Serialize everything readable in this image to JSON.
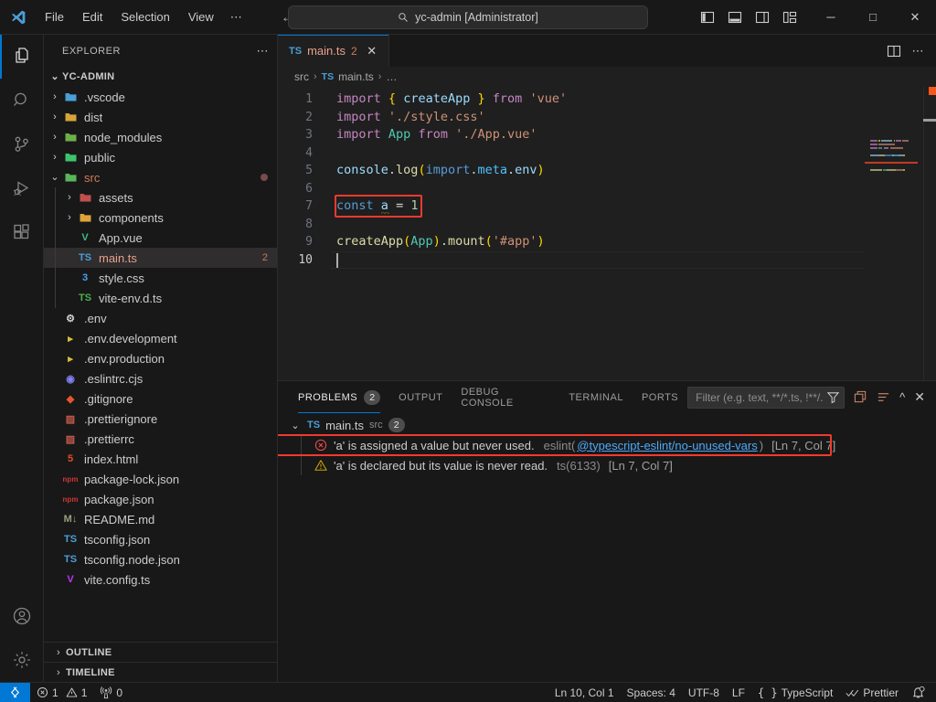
{
  "titlebar": {
    "logo": "vscode-logo",
    "menus": [
      "File",
      "Edit",
      "Selection",
      "View",
      "⋯"
    ],
    "nav": {
      "back": "←",
      "forward": "→"
    },
    "command_center": {
      "icon": "search-icon",
      "text": "yc-admin [Administrator]"
    },
    "layout_icons": [
      "toggle-primary-sidebar-icon",
      "toggle-panel-icon",
      "toggle-secondary-sidebar-icon",
      "customize-layout-icon"
    ],
    "window_buttons": {
      "minimize": "─",
      "maximize": "□",
      "close": "✕"
    }
  },
  "activitybar": {
    "items": [
      {
        "name": "explorer",
        "icon": "files-icon",
        "active": true
      },
      {
        "name": "search",
        "icon": "search-icon",
        "active": false
      },
      {
        "name": "source-control",
        "icon": "source-control-icon",
        "active": false
      },
      {
        "name": "run-and-debug",
        "icon": "run-debug-icon",
        "active": false
      },
      {
        "name": "extensions",
        "icon": "extensions-icon",
        "active": false
      }
    ],
    "bottom": [
      {
        "name": "accounts",
        "icon": "account-icon"
      },
      {
        "name": "manage",
        "icon": "gear-icon"
      }
    ]
  },
  "sidebar": {
    "title": "EXPLORER",
    "more_actions": "⋯",
    "root": {
      "label": "YC-ADMIN",
      "twisty": "⌄"
    },
    "outline": {
      "label": "OUTLINE",
      "twisty": "›"
    },
    "timeline": {
      "label": "TIMELINE",
      "twisty": "›"
    },
    "tree": [
      {
        "label": ".vscode",
        "depth": 1,
        "twisty": "›",
        "icon": "vscode-folder-icon",
        "icon_text": "",
        "icon_color": "#4a9fd8",
        "kind": "folder"
      },
      {
        "label": "dist",
        "depth": 1,
        "twisty": "›",
        "icon": "dist-folder-icon",
        "icon_text": "",
        "icon_color": "#d8a33a",
        "kind": "folder"
      },
      {
        "label": "node_modules",
        "depth": 1,
        "twisty": "›",
        "icon": "node-folder-icon",
        "icon_text": "",
        "icon_color": "#6cb04a",
        "kind": "folder"
      },
      {
        "label": "public",
        "depth": 1,
        "twisty": "›",
        "icon": "public-folder-icon",
        "icon_text": "",
        "icon_color": "#3ec46d",
        "kind": "folder"
      },
      {
        "label": "src",
        "depth": 1,
        "twisty": "⌄",
        "icon": "src-folder-icon",
        "icon_text": "",
        "icon_color": "#5ab55a",
        "kind": "folder",
        "modified": true,
        "label_color": "#cd7a5a"
      },
      {
        "label": "assets",
        "depth": 2,
        "twisty": "›",
        "icon": "assets-folder-icon",
        "icon_text": "",
        "icon_color": "#c0504d",
        "kind": "folder"
      },
      {
        "label": "components",
        "depth": 2,
        "twisty": "›",
        "icon": "components-folder-icon",
        "icon_text": "",
        "icon_color": "#e0a33a",
        "kind": "folder"
      },
      {
        "label": "App.vue",
        "depth": 2,
        "twisty": "",
        "icon": "vue-icon",
        "icon_text": "V",
        "icon_color": "#41b883",
        "kind": "file"
      },
      {
        "label": "main.ts",
        "depth": 2,
        "twisty": "",
        "icon": "typescript-icon",
        "icon_text": "TS",
        "icon_color": "#4a9fd8",
        "kind": "file",
        "selected": true,
        "badge": "2",
        "label_color": "#e8a08a",
        "badge_color": "#cd7a5a"
      },
      {
        "label": "style.css",
        "depth": 2,
        "twisty": "",
        "icon": "css-icon",
        "icon_text": "3",
        "icon_color": "#42a5f5",
        "kind": "file"
      },
      {
        "label": "vite-env.d.ts",
        "depth": 2,
        "twisty": "",
        "icon": "typescript-def-icon",
        "icon_text": "TS",
        "icon_color": "#4caf50",
        "kind": "file"
      },
      {
        "label": ".env",
        "depth": 1,
        "twisty": "",
        "icon": "gear-file-icon",
        "icon_text": "⚙",
        "icon_color": "#d0d0d0",
        "kind": "file"
      },
      {
        "label": ".env.development",
        "depth": 1,
        "twisty": "",
        "icon": "console-file-icon",
        "icon_text": "▸",
        "icon_color": "#d8c03a",
        "kind": "file"
      },
      {
        "label": ".env.production",
        "depth": 1,
        "twisty": "",
        "icon": "console-file-icon",
        "icon_text": "▸",
        "icon_color": "#d8c03a",
        "kind": "file"
      },
      {
        "label": ".eslintrc.cjs",
        "depth": 1,
        "twisty": "",
        "icon": "eslint-icon",
        "icon_text": "◉",
        "icon_color": "#8080f2",
        "kind": "file"
      },
      {
        "label": ".gitignore",
        "depth": 1,
        "twisty": "",
        "icon": "git-icon",
        "icon_text": "◆",
        "icon_color": "#e8552a",
        "kind": "file"
      },
      {
        "label": ".prettierignore",
        "depth": 1,
        "twisty": "",
        "icon": "prettier-icon",
        "icon_text": "▨",
        "icon_color": "#c25a4a",
        "kind": "file"
      },
      {
        "label": ".prettierrc",
        "depth": 1,
        "twisty": "",
        "icon": "prettier-icon",
        "icon_text": "▨",
        "icon_color": "#c25a4a",
        "kind": "file"
      },
      {
        "label": "index.html",
        "depth": 1,
        "twisty": "",
        "icon": "html-icon",
        "icon_text": "5",
        "icon_color": "#e44d26",
        "kind": "file"
      },
      {
        "label": "package-lock.json",
        "depth": 1,
        "twisty": "",
        "icon": "npm-icon",
        "icon_text": "npm",
        "icon_color": "#cb3837",
        "kind": "file"
      },
      {
        "label": "package.json",
        "depth": 1,
        "twisty": "",
        "icon": "npm-icon",
        "icon_text": "npm",
        "icon_color": "#cb3837",
        "kind": "file"
      },
      {
        "label": "README.md",
        "depth": 1,
        "twisty": "",
        "icon": "markdown-icon",
        "icon_text": "M↓",
        "icon_color": "#9c9c82",
        "kind": "file"
      },
      {
        "label": "tsconfig.json",
        "depth": 1,
        "twisty": "",
        "icon": "tsconfig-icon",
        "icon_text": "TS",
        "icon_color": "#4a9fd8",
        "kind": "file"
      },
      {
        "label": "tsconfig.node.json",
        "depth": 1,
        "twisty": "",
        "icon": "tsconfig-icon",
        "icon_text": "TS",
        "icon_color": "#4a9fd8",
        "kind": "file"
      },
      {
        "label": "vite.config.ts",
        "depth": 1,
        "twisty": "",
        "icon": "vite-icon",
        "icon_text": "V",
        "icon_color": "#bd34fe",
        "kind": "file"
      }
    ]
  },
  "editor": {
    "tab": {
      "icon_text": "TS",
      "name": "main.ts",
      "badge": "2",
      "close": "✕"
    },
    "tab_actions": [
      "split-editor-icon",
      "more-actions-icon"
    ],
    "breadcrumbs": [
      "src",
      "main.ts",
      "…"
    ],
    "breadcrumb_icon": "TS",
    "lines": [
      {
        "n": "1",
        "tokens": [
          {
            "t": "import",
            "c": "k"
          },
          {
            "t": " ",
            "c": "op"
          },
          {
            "t": "{",
            "c": "pm"
          },
          {
            "t": " ",
            "c": "op"
          },
          {
            "t": "createApp",
            "c": "id"
          },
          {
            "t": " ",
            "c": "op"
          },
          {
            "t": "}",
            "c": "pm"
          },
          {
            "t": " ",
            "c": "op"
          },
          {
            "t": "from",
            "c": "k"
          },
          {
            "t": " ",
            "c": "op"
          },
          {
            "t": "'vue'",
            "c": "str"
          }
        ]
      },
      {
        "n": "2",
        "tokens": [
          {
            "t": "import",
            "c": "k"
          },
          {
            "t": " ",
            "c": "op"
          },
          {
            "t": "'./style.css'",
            "c": "str"
          }
        ]
      },
      {
        "n": "3",
        "tokens": [
          {
            "t": "import",
            "c": "k"
          },
          {
            "t": " ",
            "c": "op"
          },
          {
            "t": "App",
            "c": "cls"
          },
          {
            "t": " ",
            "c": "op"
          },
          {
            "t": "from",
            "c": "k"
          },
          {
            "t": " ",
            "c": "op"
          },
          {
            "t": "'./App.vue'",
            "c": "str"
          }
        ]
      },
      {
        "n": "4",
        "tokens": []
      },
      {
        "n": "5",
        "tokens": [
          {
            "t": "console",
            "c": "id"
          },
          {
            "t": ".",
            "c": "op"
          },
          {
            "t": "log",
            "c": "fn"
          },
          {
            "t": "(",
            "c": "pm"
          },
          {
            "t": "import",
            "c": "kb"
          },
          {
            "t": ".",
            "c": "op"
          },
          {
            "t": "meta",
            "c": "mod"
          },
          {
            "t": ".",
            "c": "op"
          },
          {
            "t": "env",
            "c": "id"
          },
          {
            "t": ")",
            "c": "pm"
          }
        ]
      },
      {
        "n": "6",
        "tokens": []
      },
      {
        "n": "7",
        "tokens": [
          {
            "t": "const",
            "c": "kb"
          },
          {
            "t": " ",
            "c": "op"
          },
          {
            "t": "a",
            "c": "id"
          },
          {
            "t": " ",
            "c": "op"
          },
          {
            "t": "=",
            "c": "op"
          },
          {
            "t": " ",
            "c": "op"
          },
          {
            "t": "1",
            "c": "num"
          }
        ]
      },
      {
        "n": "8",
        "tokens": []
      },
      {
        "n": "9",
        "tokens": [
          {
            "t": "createApp",
            "c": "fn"
          },
          {
            "t": "(",
            "c": "pm"
          },
          {
            "t": "App",
            "c": "cls"
          },
          {
            "t": ")",
            "c": "pm"
          },
          {
            "t": ".",
            "c": "op"
          },
          {
            "t": "mount",
            "c": "fn"
          },
          {
            "t": "(",
            "c": "pm"
          },
          {
            "t": "'#app'",
            "c": "str"
          },
          {
            "t": ")",
            "c": "pm"
          }
        ]
      },
      {
        "n": "10",
        "tokens": [],
        "current": true
      }
    ],
    "annotation": {
      "type": "red-rectangle",
      "target_line": 7,
      "color": "#f03a2f"
    },
    "squiggle": {
      "line": 7,
      "color": "#cca700"
    }
  },
  "panel": {
    "tabs": [
      {
        "label": "PROBLEMS",
        "count": "2",
        "active": true
      },
      {
        "label": "OUTPUT",
        "count": "",
        "active": false
      },
      {
        "label": "DEBUG CONSOLE",
        "count": "",
        "active": false
      },
      {
        "label": "TERMINAL",
        "count": "",
        "active": false
      },
      {
        "label": "PORTS",
        "count": "",
        "active": false
      }
    ],
    "filter": {
      "placeholder": "Filter (e.g. text, **/*.ts, !**/...",
      "value": "",
      "icon": "filter-icon"
    },
    "actions": [
      "view-as-table-icon",
      "collapse-all-icon",
      "chevron-up-icon",
      "close-icon"
    ],
    "file_group": {
      "icon_text": "TS",
      "name": "main.ts",
      "folder": "src",
      "count": "2",
      "twisty": "⌄"
    },
    "items": [
      {
        "severity": "error",
        "icon": "error-icon",
        "message": "'a' is assigned a value but never used.",
        "source_prefix": "eslint(",
        "source_link": "@typescript-eslint/no-unused-vars",
        "source_suffix": ")",
        "location": "[Ln 7, Col 7]",
        "boxed": true
      },
      {
        "severity": "warning",
        "icon": "warning-icon",
        "message": "'a' is declared but its value is never read.",
        "source_prefix": "ts(6133)",
        "source_link": "",
        "source_suffix": "",
        "location": "[Ln 7, Col 7]",
        "boxed": false
      }
    ]
  },
  "statusbar": {
    "remote": {
      "icon": "remote-icon",
      "label": ""
    },
    "left": [
      {
        "name": "errors-warnings",
        "icon": "error-icon",
        "error_count": "1",
        "warning_icon": "warning-icon",
        "warning_count": "1"
      },
      {
        "name": "ports",
        "icon": "radio-tower-icon",
        "count": "0"
      }
    ],
    "right": [
      {
        "name": "cursor-position",
        "label": "Ln 10, Col 1"
      },
      {
        "name": "indentation",
        "label": "Spaces: 4"
      },
      {
        "name": "encoding",
        "label": "UTF-8"
      },
      {
        "name": "eol",
        "label": "LF"
      },
      {
        "name": "language-mode",
        "label": "TypeScript",
        "icon": "braces-icon"
      },
      {
        "name": "prettier",
        "label": "Prettier",
        "icon": "checkmarks-icon"
      },
      {
        "name": "notifications",
        "label": "",
        "icon": "bell-dot-icon"
      }
    ]
  },
  "colors": {
    "accent": "#0078d4",
    "error": "#f14c4c",
    "warning": "#cca700",
    "annotation": "#f03a2f",
    "bg": "#1f1f1f",
    "chrome": "#181818"
  }
}
